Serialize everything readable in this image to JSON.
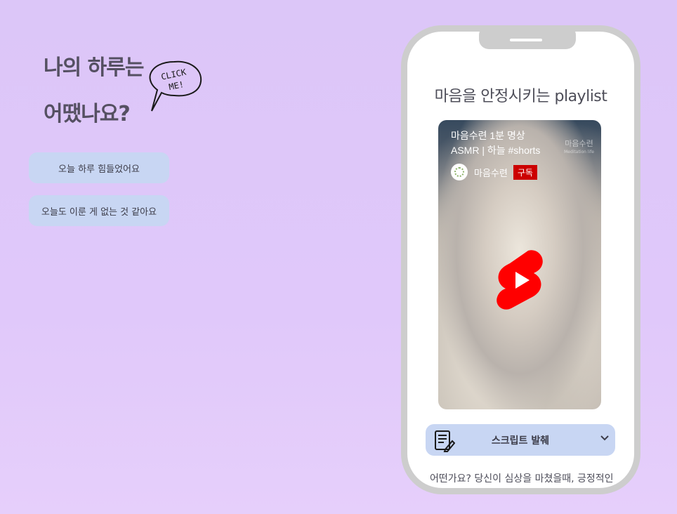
{
  "heading": {
    "line1": "나의 하루는",
    "line2": "어땠나요?"
  },
  "bubble": {
    "line1": "CLICK",
    "line2": "ME!"
  },
  "mood_buttons": [
    {
      "label": "오늘 하루 힘들었어요"
    },
    {
      "label": "오늘도 이룬 게 없는 것 같아요"
    }
  ],
  "phone": {
    "title": "마음을 안정시키는 playlist",
    "video": {
      "title_line1": "마음수련 1분 명상",
      "title_line2": "ASMR | 하늘 #shorts",
      "watermark": "마음수련",
      "watermark_sub": "Meditation life",
      "channel_name": "마음수련",
      "subscribe_label": "구독"
    },
    "script_bar": {
      "label": "스크립트 발췌"
    },
    "script_text": "어떤가요? 당신이 심상을 마쳤을때, 긍정적인 기분으로 편안히 쉬세요."
  },
  "colors": {
    "button_bg": "#c8d6f3",
    "subscribe": "#cc0000",
    "shorts_red": "#ff0000",
    "frame": "#cdcdcd"
  }
}
